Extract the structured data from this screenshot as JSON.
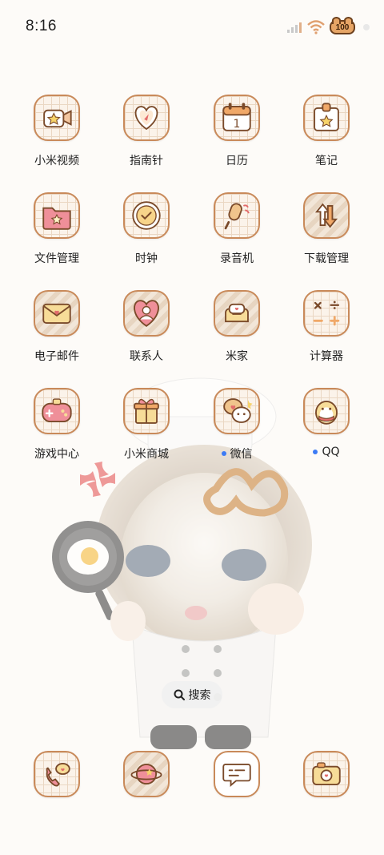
{
  "status_bar": {
    "time": "8:16",
    "battery_label": "100"
  },
  "apps": [
    {
      "label": "小米视频",
      "icon": "video-camera-icon"
    },
    {
      "label": "指南针",
      "icon": "compass-heart-icon"
    },
    {
      "label": "日历",
      "icon": "calendar-icon",
      "day": "1"
    },
    {
      "label": "笔记",
      "icon": "notes-icon"
    },
    {
      "label": "文件管理",
      "icon": "folder-star-icon"
    },
    {
      "label": "时钟",
      "icon": "clock-icon"
    },
    {
      "label": "录音机",
      "icon": "microphone-icon"
    },
    {
      "label": "下载管理",
      "icon": "download-arrows-icon"
    },
    {
      "label": "电子邮件",
      "icon": "envelope-heart-icon"
    },
    {
      "label": "联系人",
      "icon": "contact-heart-icon"
    },
    {
      "label": "米家",
      "icon": "sofa-icon"
    },
    {
      "label": "计算器",
      "icon": "calculator-icon"
    },
    {
      "label": "游戏中心",
      "icon": "gamepad-icon"
    },
    {
      "label": "小米商城",
      "icon": "gift-box-icon"
    },
    {
      "label": "微信",
      "icon": "wechat-bubble-icon",
      "new_badge": true
    },
    {
      "label": "QQ",
      "icon": "penguin-icon",
      "new_badge": true
    }
  ],
  "search": {
    "label": "搜索"
  },
  "dock": [
    {
      "icon": "phone-heart-icon"
    },
    {
      "icon": "planet-star-icon"
    },
    {
      "icon": "message-bubble-icon"
    },
    {
      "icon": "camera-heart-icon"
    }
  ],
  "colors": {
    "accent": "#c98a5a",
    "badge": "#3c7bf5",
    "background": "#fdfbf8"
  }
}
